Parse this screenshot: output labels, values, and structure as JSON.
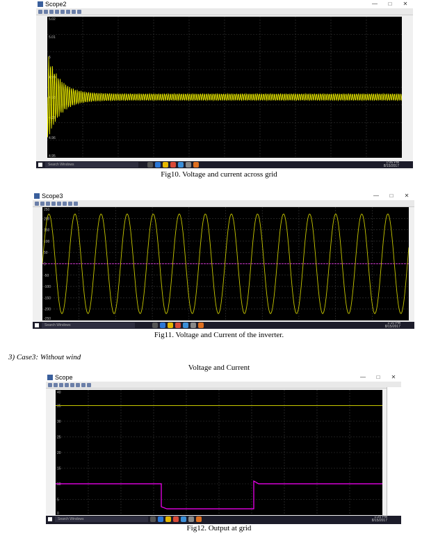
{
  "figures": [
    {
      "window_title": "Scope2",
      "y_ticks": [
        "5.02",
        "5.01",
        "5",
        "4.99",
        "4.98",
        "4.97",
        "4.96",
        "4.95"
      ],
      "taskbar": {
        "search": "Search Windows",
        "time": "1:06 PM",
        "date": "8/15/2017"
      },
      "caption": "Fig10. Voltage and current across grid",
      "colors": {
        "trace": "#ffff00"
      }
    },
    {
      "window_title": "Scope3",
      "y_ticks": [
        "250",
        "200",
        "150",
        "100",
        "50",
        "0",
        "-50",
        "-100",
        "-150",
        "-200",
        "-250"
      ],
      "taskbar": {
        "search": "Search Windows",
        "time": "1:10 PM",
        "date": "8/15/2017"
      },
      "caption": "Fig11. Voltage and Current of the inverter.",
      "colors": {
        "trace": "#c8c800",
        "trace2": "#ff40ff"
      }
    },
    {
      "window_title": "Scope",
      "y_ticks": [
        "40",
        "35",
        "30",
        "25",
        "20",
        "15",
        "10",
        "5",
        "0"
      ],
      "taskbar": {
        "search": "Search Windows",
        "time": "1:25 PM",
        "date": "8/15/2017"
      },
      "caption": "Fig12. Output at grid",
      "colors": {
        "trace": "#c8c800",
        "trace2": "#ff00ff"
      }
    }
  ],
  "section_label": "3)    Case3: Without wind",
  "subheading": "Voltage and Current"
}
